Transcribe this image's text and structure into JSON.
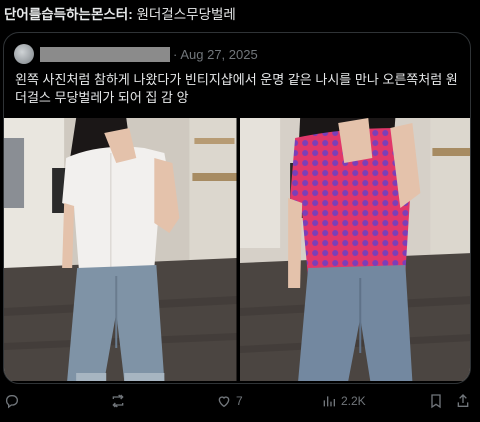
{
  "post": {
    "author": "단어를습득하는몬스터:",
    "title": "원더걸스무당벌레"
  },
  "quoted": {
    "date": "Aug 27, 2025",
    "text": "왼쪽 사진처럼 참하게 나왔다가 빈티지샵에서 운명 같은 나시를 만나 오른쪽처럼 원더걸스 무당벌레가 되어 집 감 앙"
  },
  "actions": {
    "like_count": "7",
    "view_count": "2.2K"
  },
  "icons": [
    "reply-icon",
    "retweet-icon",
    "like-icon",
    "views-icon",
    "bookmark-icon",
    "share-icon"
  ],
  "colors": {
    "muted": "#71767b",
    "border": "#2f3336",
    "shirt_pink": "#e0376a",
    "dot_purple": "#7b3fb8"
  }
}
